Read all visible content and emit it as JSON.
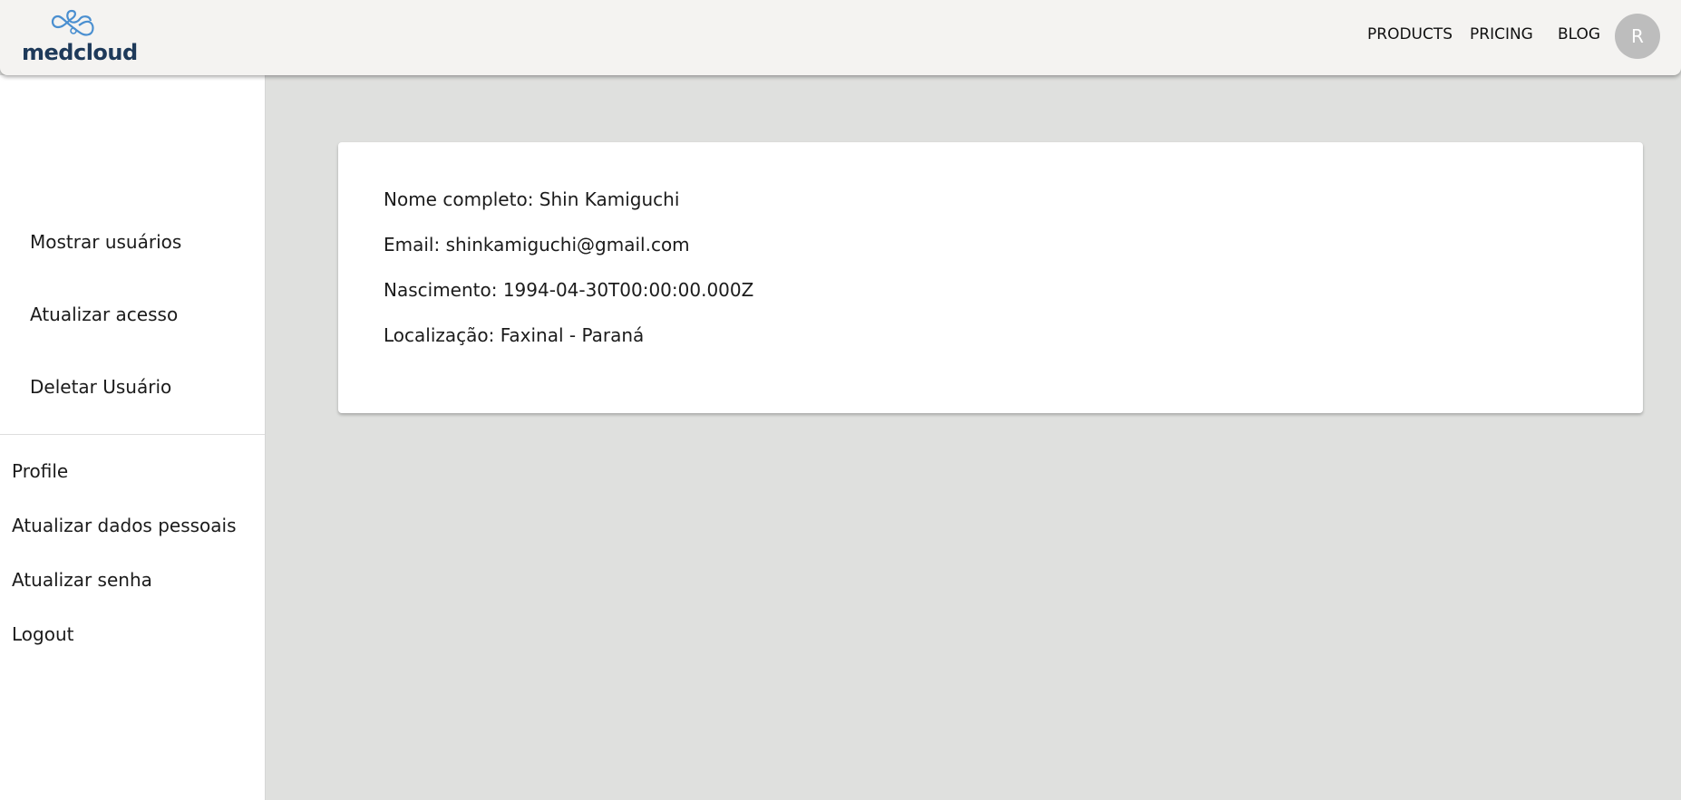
{
  "header": {
    "logo_text": "medcloud",
    "nav": {
      "products": "PRODUCTS",
      "pricing": "PRICING",
      "blog": "BLOG"
    },
    "avatar_initial": "R"
  },
  "sidebar": {
    "admin_items": [
      {
        "label": "Mostrar usuários"
      },
      {
        "label": "Atualizar acesso"
      },
      {
        "label": "Deletar Usuário"
      }
    ],
    "user_items": [
      {
        "label": "Profile"
      },
      {
        "label": "Atualizar dados pessoais"
      },
      {
        "label": "Atualizar senha"
      },
      {
        "label": "Logout"
      }
    ]
  },
  "profile": {
    "name_line": "Nome completo: Shin Kamiguchi",
    "email_line": "Email: shinkamiguchi@gmail.com",
    "birth_line": "Nascimento: 1994-04-30T00:00:00.000Z",
    "location_line": "Localização: Faxinal - Paraná"
  },
  "colors": {
    "header_bg": "#f4f3f1",
    "content_bg": "#dfe0de",
    "logo_text": "#1e3a5a",
    "logo_icon": "#4a8fd0",
    "avatar_bg": "#bdbdbd"
  }
}
